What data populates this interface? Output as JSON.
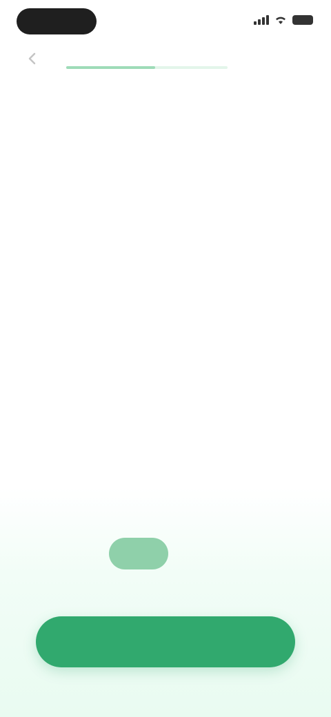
{
  "colors": {
    "accent": "#31a96e",
    "accent_light": "#8fd0aa",
    "text_dark": "#3b3b3b"
  },
  "status_bar": {
    "icons": [
      "signal-icon",
      "wifi-icon",
      "battery-icon"
    ]
  },
  "nav": {
    "back_icon": "chevron-left-icon",
    "progress_label": "",
    "progress": 0.55,
    "skip_label": ""
  },
  "question": {
    "line_before": "",
    "highlight": "",
    "line_after": ""
  },
  "hint": "",
  "options": [
    {
      "label": "",
      "emphasis": false
    },
    {
      "label": "",
      "emphasis": false
    },
    {
      "label": "",
      "emphasis": false
    },
    {
      "label": "",
      "emphasis": true
    },
    {
      "label": "",
      "emphasis": true
    },
    {
      "label": "",
      "emphasis": true
    },
    {
      "label": "",
      "emphasis": false
    },
    {
      "label": "",
      "emphasis": false
    }
  ],
  "toggle": {
    "label": ""
  },
  "continue_button": {
    "label": ""
  }
}
